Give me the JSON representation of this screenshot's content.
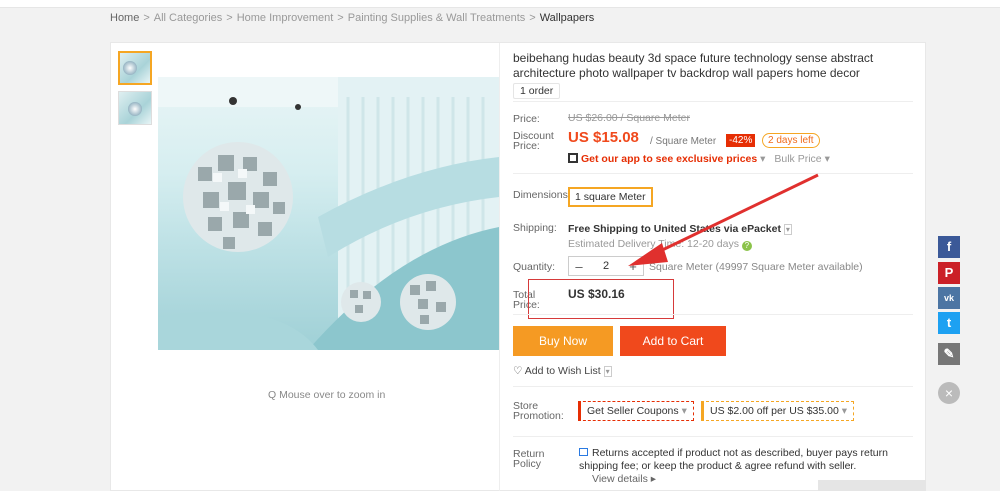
{
  "breadcrumb": {
    "items": [
      "Home",
      "All Categories",
      "Home Improvement",
      "Painting Supplies & Wall Treatments",
      "Wallpapers"
    ],
    "separator": ">"
  },
  "gallery": {
    "zoom_hint": "Q Mouse over to zoom in"
  },
  "product": {
    "title": "beibehang hudas beauty 3d space future technology sense abstract architecture photo wallpaper tv backdrop wall papers home decor",
    "orders": "1 order"
  },
  "price": {
    "label": "Price:",
    "original": "US $26.00 / Square Meter",
    "discount_label": "Discount Price:",
    "discount_price": "US $15.08",
    "unit": "/ Square Meter",
    "discount_pct": "-42%",
    "time_left": "2 days left",
    "app_promo": "Get our app to see exclusive prices",
    "bulk_price": "Bulk Price"
  },
  "options": {
    "dimensions_label": "Dimensions:",
    "dimensions_value": "1 square Meter"
  },
  "shipping": {
    "label": "Shipping:",
    "text": "Free Shipping to United States via ePacket",
    "eta": "Estimated Delivery Time: 12-20 days"
  },
  "quantity": {
    "label": "Quantity:",
    "minus": "–",
    "value": "2",
    "plus": "+",
    "available": "Square Meter (49997 Square Meter available)"
  },
  "total": {
    "label": "Total Price:",
    "value": "US $30.16"
  },
  "actions": {
    "buy_now": "Buy Now",
    "add_to_cart": "Add to Cart",
    "wishlist": "Add to Wish List"
  },
  "promotion": {
    "label": "Store Promotion:",
    "coupon": "Get Seller Coupons",
    "deal": "US $2.00 off per US $35.00"
  },
  "returns": {
    "label": "Return Policy",
    "text": "Returns accepted if product not as described, buyer pays return shipping fee; or keep the product & agree refund with seller.",
    "view_details": "View details"
  },
  "colors": {
    "accent_orange": "#f59a23",
    "cart_red": "#f0491c",
    "price_red": "#f0491c"
  }
}
